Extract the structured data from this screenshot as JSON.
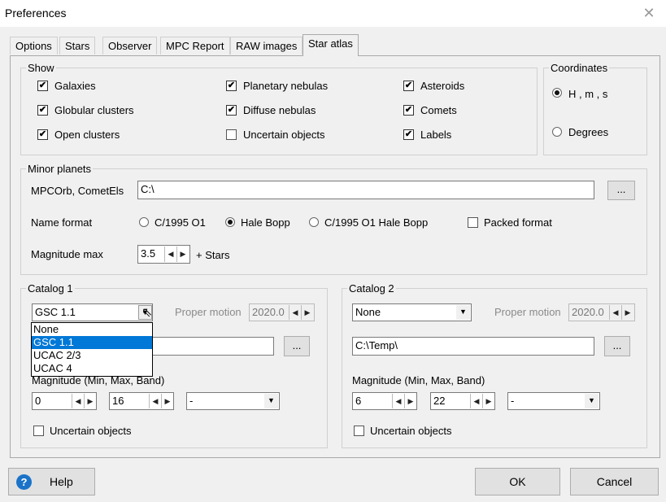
{
  "window": {
    "title": "Preferences",
    "close_glyph": "✕"
  },
  "tabs": [
    {
      "label": "Options"
    },
    {
      "label": "Stars"
    },
    {
      "label": "Observer"
    },
    {
      "label": "MPC Report"
    },
    {
      "label": "RAW images"
    },
    {
      "label": "Star atlas"
    }
  ],
  "show": {
    "legend": "Show",
    "items": [
      {
        "label": "Galaxies",
        "checked": true
      },
      {
        "label": "Globular clusters",
        "checked": true
      },
      {
        "label": "Open clusters",
        "checked": true
      },
      {
        "label": "Planetary nebulas",
        "checked": true
      },
      {
        "label": "Diffuse nebulas",
        "checked": true
      },
      {
        "label": "Uncertain objects",
        "checked": false
      },
      {
        "label": "Asteroids",
        "checked": true
      },
      {
        "label": "Comets",
        "checked": true
      },
      {
        "label": "Labels",
        "checked": true
      }
    ]
  },
  "coordinates": {
    "legend": "Coordinates",
    "options": [
      {
        "label": "H , m , s",
        "selected": true
      },
      {
        "label": "Degrees",
        "selected": false
      }
    ]
  },
  "minor_planets": {
    "legend": "Minor planets",
    "mpcorb_label": "MPCOrb, CometEls",
    "mpcorb_value": "C:\\",
    "browse_label": "...",
    "name_format_label": "Name format",
    "name_formats": [
      {
        "label": "C/1995 O1",
        "selected": false
      },
      {
        "label": "Hale Bopp",
        "selected": true
      },
      {
        "label": "C/1995 O1 Hale Bopp",
        "selected": false
      }
    ],
    "packed_format_label": "Packed format",
    "packed_format_checked": false,
    "magnitude_max_label": "Magnitude max",
    "magnitude_max_value": "3.5",
    "plus_stars_label": "+  Stars"
  },
  "catalog1": {
    "legend": "Catalog 1",
    "selected": "GSC 1.1",
    "options": [
      "None",
      "GSC 1.1",
      "UCAC 2/3",
      "UCAC 4"
    ],
    "proper_motion_label": "Proper motion",
    "proper_motion_value": "2020.0",
    "path_value": "",
    "browse_label": "...",
    "magnitude_label": "Magnitude (Min, Max, Band)",
    "mag_min": "0",
    "mag_max": "16",
    "band": "-",
    "uncertain_label": "Uncertain objects",
    "uncertain_checked": false
  },
  "catalog2": {
    "legend": "Catalog 2",
    "selected": "None",
    "proper_motion_label": "Proper motion",
    "proper_motion_value": "2020.0",
    "path_value": "C:\\Temp\\",
    "browse_label": "...",
    "magnitude_label": "Magnitude (Min, Max, Band)",
    "mag_min": "6",
    "mag_max": "22",
    "band": "-",
    "uncertain_label": "Uncertain objects",
    "uncertain_checked": false
  },
  "footer": {
    "help_label": "Help",
    "help_icon": "?",
    "ok_label": "OK",
    "cancel_label": "Cancel"
  },
  "glyphs": {
    "check": "✔",
    "spin_left": "◀",
    "spin_right": "▶",
    "arrow_down": "▼"
  },
  "colors": {
    "selection": "#0078d7",
    "help_icon": "#1a73c8"
  }
}
